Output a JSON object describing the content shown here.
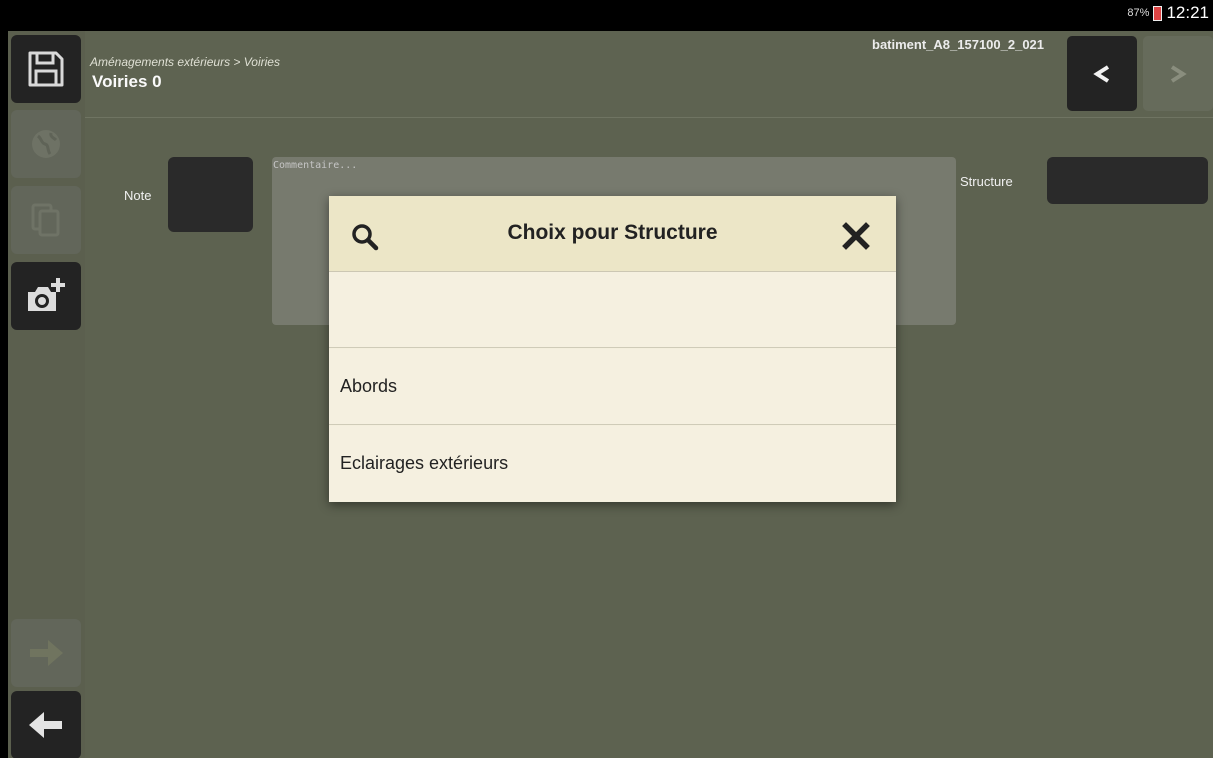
{
  "status_bar": {
    "battery_percent": "87%",
    "battery_icon": "battery-charging-icon",
    "time": "12:21"
  },
  "sidebar": {
    "items": [
      {
        "icon": "save-icon",
        "state": "active"
      },
      {
        "icon": "globe-icon",
        "state": "disabled"
      },
      {
        "icon": "copy-icon",
        "state": "disabled"
      },
      {
        "icon": "add-photo-icon",
        "state": "active"
      },
      {
        "icon": "arrow-right-icon",
        "state": "disabled"
      },
      {
        "icon": "arrow-left-icon",
        "state": "active"
      }
    ]
  },
  "header": {
    "breadcrumb": "Aménagements extérieurs > Voiries",
    "title": "Voiries 0",
    "record_id": "batiment_A8_157100_2_021",
    "prev_label": "<",
    "next_label": ">"
  },
  "form": {
    "note_label": "Note",
    "comment_placeholder": "Commentaire...",
    "structure_label": "Structure"
  },
  "dialog": {
    "title": "Choix pour Structure",
    "options": [
      "",
      "Abords",
      "Eclairages extérieurs"
    ]
  },
  "colors": {
    "background": "#5d6250",
    "dark_button": "#232323",
    "dialog_header": "#ece6c7",
    "dialog_body": "#f4efdd"
  }
}
